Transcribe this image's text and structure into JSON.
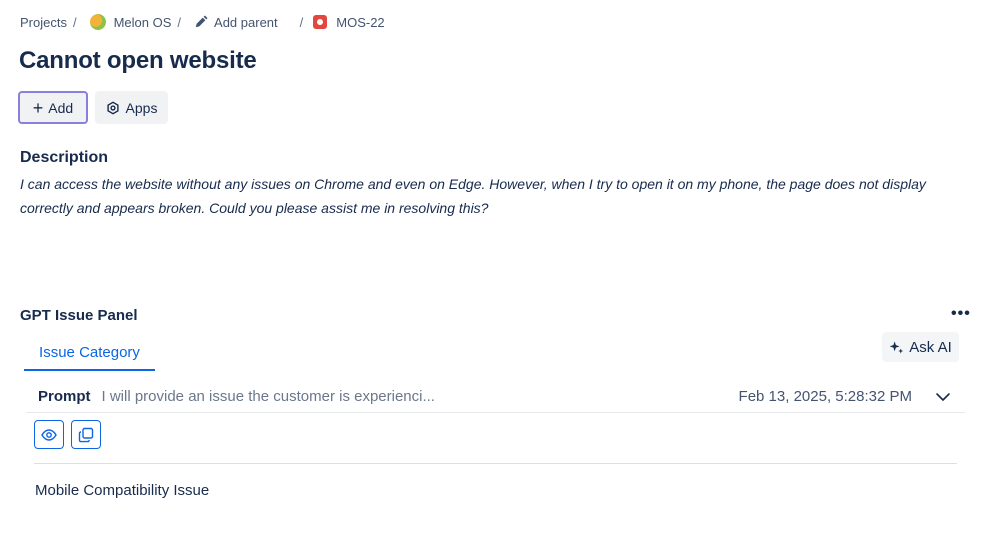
{
  "breadcrumb": {
    "projects": "Projects",
    "project": "Melon OS",
    "add_parent": "Add parent",
    "issue_key": "MOS-22",
    "separator": "/"
  },
  "issue": {
    "title": "Cannot open website"
  },
  "actions": {
    "add_label": "Add",
    "apps_label": "Apps"
  },
  "description": {
    "heading": "Description",
    "text": "I can access the website without any issues on Chrome and even on Edge. However, when I try to open it on my phone, the page does not display correctly and appears broken. Could you please assist me in resolving this?"
  },
  "panel": {
    "title": "GPT Issue Panel",
    "more_label": "•••",
    "tab_label": "Issue Category",
    "ask_ai_label": "Ask AI",
    "prompt": {
      "label": "Prompt",
      "preview": "I will provide an issue the customer is experienci...",
      "timestamp": "Feb 13, 2025, 5:28:32 PM"
    },
    "result": "Mobile Compatibility Issue"
  },
  "colors": {
    "accent": "#0c66e4",
    "focus_ring": "#8b7fdc",
    "bug_red": "#e2483d",
    "text_primary": "#172b4d"
  },
  "icons": [
    "melon-os-logo-icon",
    "pencil-icon",
    "bug-icon",
    "plus-icon",
    "apps-icon",
    "more-icon",
    "sparkle-icon",
    "chevron-down-icon",
    "eye-icon",
    "copy-icon"
  ]
}
